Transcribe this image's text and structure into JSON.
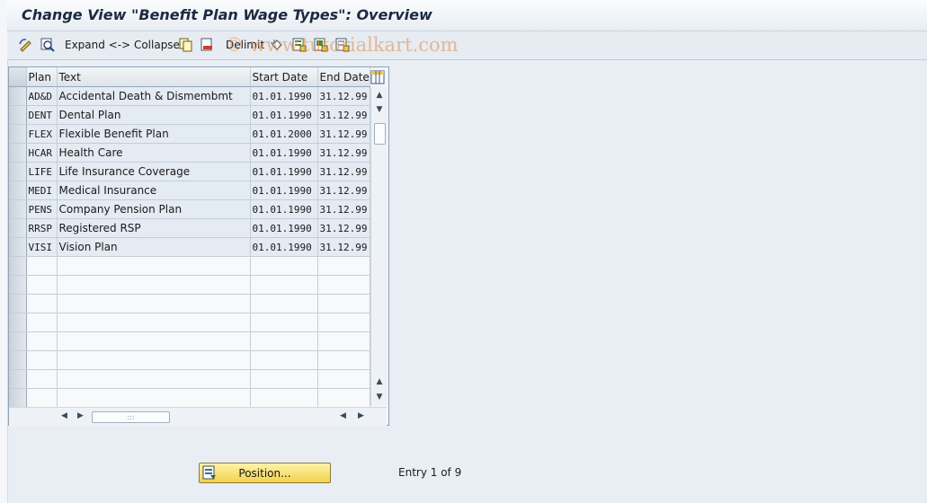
{
  "window": {
    "title": "Change View \"Benefit Plan Wage Types\": Overview"
  },
  "toolbar": {
    "expand_collapse_label": "Expand <-> Collapse",
    "delimit_label": "Delimit",
    "icons": [
      "change-display-icon",
      "details-icon",
      "copy-icon",
      "delete-icon",
      "undo-icon",
      "select-all-icon",
      "select-block-icon",
      "deselect-all-icon"
    ]
  },
  "watermark": "© www.tutorialkart.com",
  "table": {
    "columns": [
      "Plan",
      "Text",
      "Start Date",
      "End Date"
    ],
    "rows": [
      {
        "plan": "AD&D",
        "text": "Accidental Death & Dismembmt",
        "start": "01.01.1990",
        "end": "31.12.99"
      },
      {
        "plan": "DENT",
        "text": "Dental Plan",
        "start": "01.01.1990",
        "end": "31.12.99"
      },
      {
        "plan": "FLEX",
        "text": "Flexible Benefit Plan",
        "start": "01.01.2000",
        "end": "31.12.99"
      },
      {
        "plan": "HCAR",
        "text": "Health Care",
        "start": "01.01.1990",
        "end": "31.12.99"
      },
      {
        "plan": "LIFE",
        "text": "Life Insurance Coverage",
        "start": "01.01.1990",
        "end": "31.12.99"
      },
      {
        "plan": "MEDI",
        "text": "Medical Insurance",
        "start": "01.01.1990",
        "end": "31.12.99"
      },
      {
        "plan": "PENS",
        "text": "Company Pension Plan",
        "start": "01.01.1990",
        "end": "31.12.99"
      },
      {
        "plan": "RRSP",
        "text": "Registered RSP",
        "start": "01.01.1990",
        "end": "31.12.99"
      },
      {
        "plan": "VISI",
        "text": "Vision Plan",
        "start": "01.01.1990",
        "end": "31.12.99"
      }
    ],
    "empty_rows": 8
  },
  "footer": {
    "position_button_label": "Position...",
    "entry_text": "Entry 1 of 9"
  },
  "colors": {
    "title": "#1b2a40",
    "button_yellow": "#f2d24e",
    "row_fill": "#e4ebf2"
  }
}
